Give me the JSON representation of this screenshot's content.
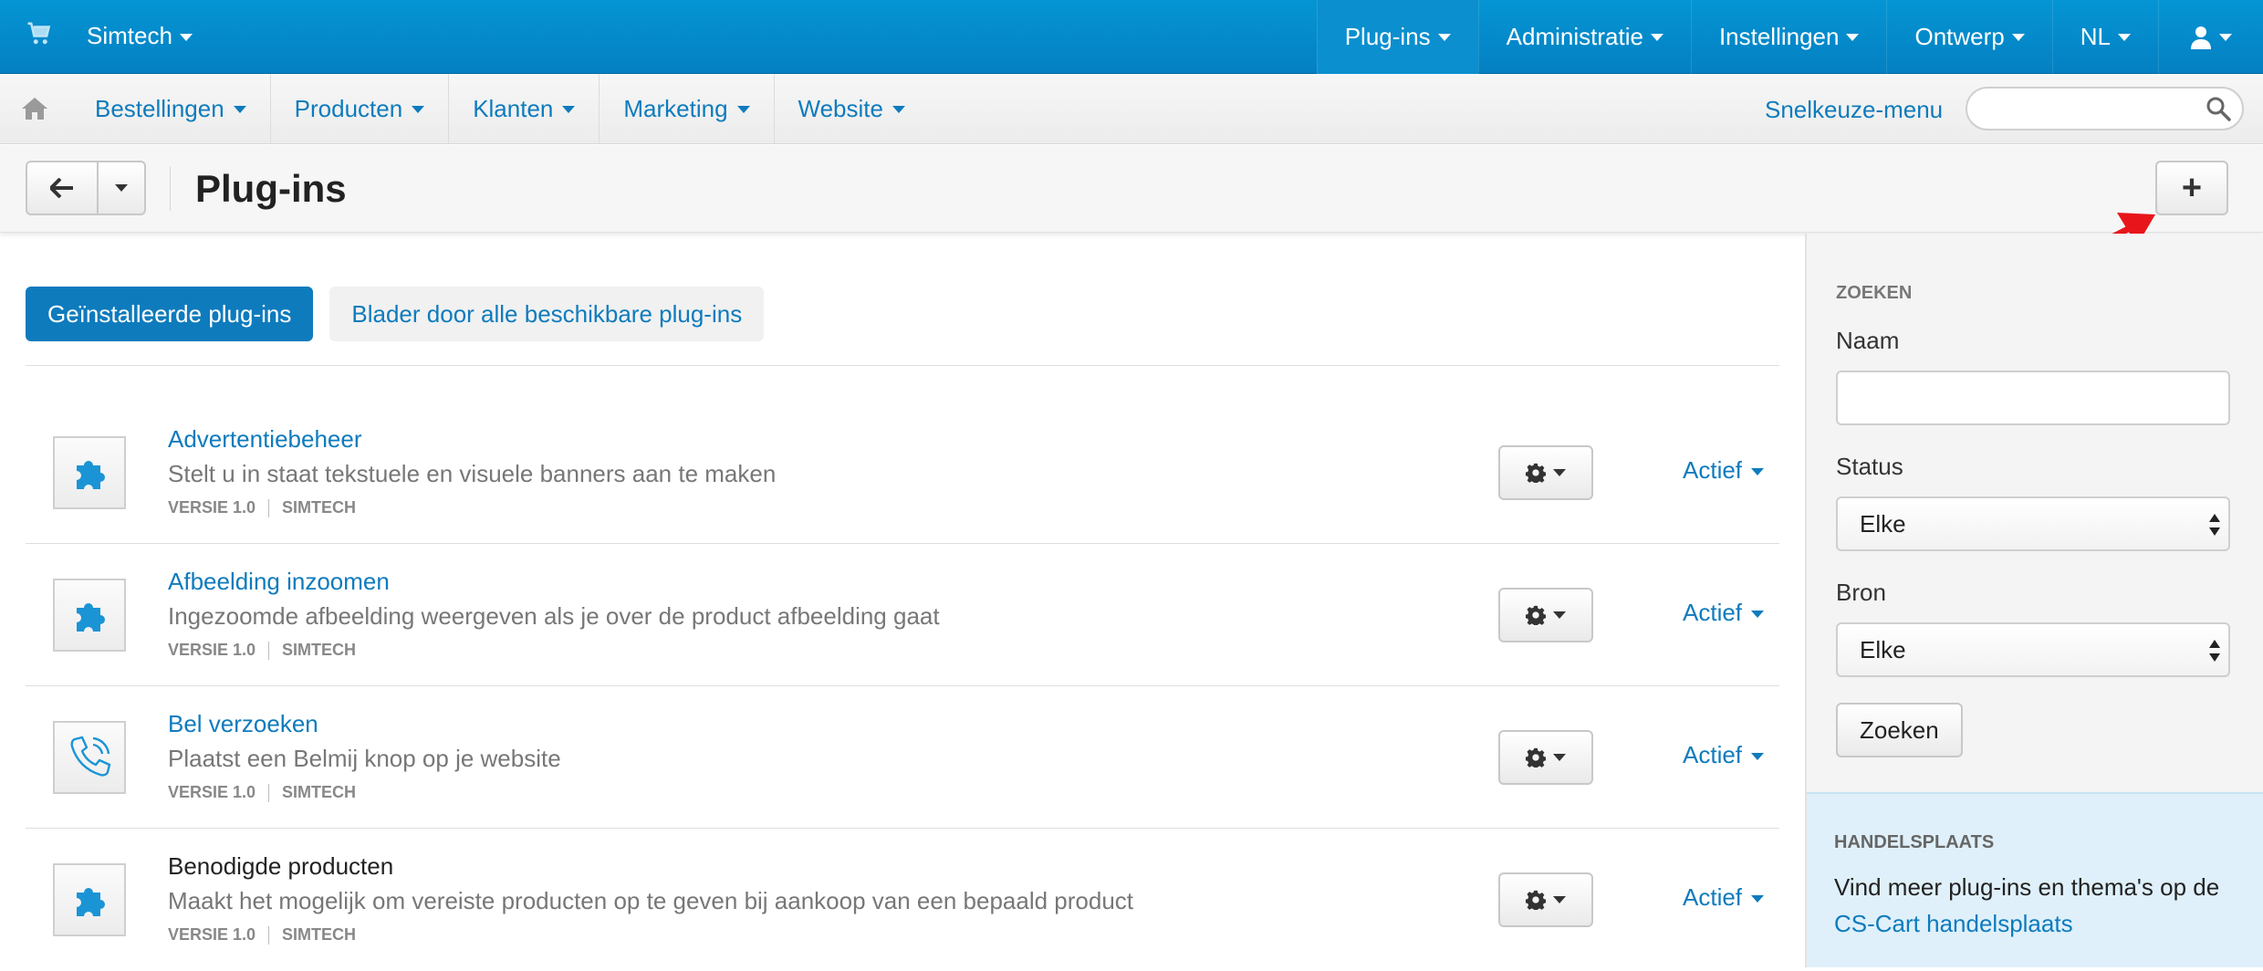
{
  "topbar": {
    "cart_icon": "shopping-cart-icon",
    "brand": "Simtech",
    "nav": [
      {
        "label": "Plug-ins",
        "active": true
      },
      {
        "label": "Administratie"
      },
      {
        "label": "Instellingen"
      },
      {
        "label": "Ontwerp"
      },
      {
        "label": "NL"
      }
    ],
    "user_icon": "user-icon"
  },
  "subbar": {
    "home_icon": "home-icon",
    "nav": [
      "Bestellingen",
      "Producten",
      "Klanten",
      "Marketing",
      "Website"
    ],
    "quick_menu": "Snelkeuze-menu",
    "search_placeholder": "",
    "search_icon": "search-icon"
  },
  "titlebar": {
    "title": "Plug-ins",
    "add_label": "+"
  },
  "tabs": {
    "installed": "Geïnstalleerde plug-ins",
    "browse": "Blader door alle beschikbare plug-ins"
  },
  "plugins": [
    {
      "name": "Advertentiebeheer",
      "desc": "Stelt u in staat tekstuele en visuele banners aan te maken",
      "version": "VERSIE 1.0",
      "vendor": "SIMTECH",
      "status": "Actief",
      "icon": "puzzle-icon",
      "linked": true
    },
    {
      "name": "Afbeelding inzoomen",
      "desc": "Ingezoomde afbeelding weergeven als je over de product afbeelding gaat",
      "version": "VERSIE 1.0",
      "vendor": "SIMTECH",
      "status": "Actief",
      "icon": "puzzle-icon",
      "linked": true
    },
    {
      "name": "Bel verzoeken",
      "desc": "Plaatst een Belmij knop op je website",
      "version": "VERSIE 1.0",
      "vendor": "SIMTECH",
      "status": "Actief",
      "icon": "phone-icon",
      "linked": true
    },
    {
      "name": "Benodigde producten",
      "desc": "Maakt het mogelijk om vereiste producten op te geven bij aankoop van een bepaald product",
      "version": "VERSIE 1.0",
      "vendor": "SIMTECH",
      "status": "Actief",
      "icon": "puzzle-icon",
      "linked": false
    }
  ],
  "sidebar": {
    "search_heading": "ZOEKEN",
    "name_label": "Naam",
    "name_value": "",
    "status_label": "Status",
    "status_value": "Elke",
    "source_label": "Bron",
    "source_value": "Elke",
    "search_button": "Zoeken",
    "market_heading": "HANDELSPLAATS",
    "market_text": "Vind meer plug-ins en thema's op de",
    "market_link": "CS-Cart handelsplaats"
  },
  "colors": {
    "accent": "#0e7bbd",
    "topbar": "#0595d4",
    "annotation_arrow": "#e8161b"
  }
}
